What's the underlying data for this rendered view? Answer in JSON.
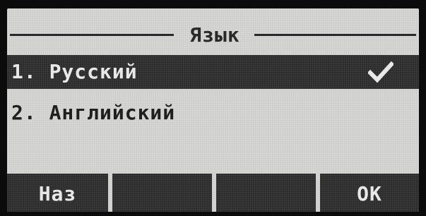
{
  "screen": {
    "title": "Язык"
  },
  "menu": {
    "items": [
      {
        "label": "1. Русский",
        "selected": true,
        "icon": "check-icon"
      },
      {
        "label": "2. Английский",
        "selected": false
      }
    ]
  },
  "softkeys": [
    {
      "label": "Наз"
    },
    {
      "label": ""
    },
    {
      "label": ""
    },
    {
      "label": "OK"
    }
  ],
  "colors": {
    "lcd_background": "#d7d7d5",
    "highlight": "#2b2b2b",
    "text_dark": "#1c1c1c",
    "text_light": "#e8e8e8"
  }
}
